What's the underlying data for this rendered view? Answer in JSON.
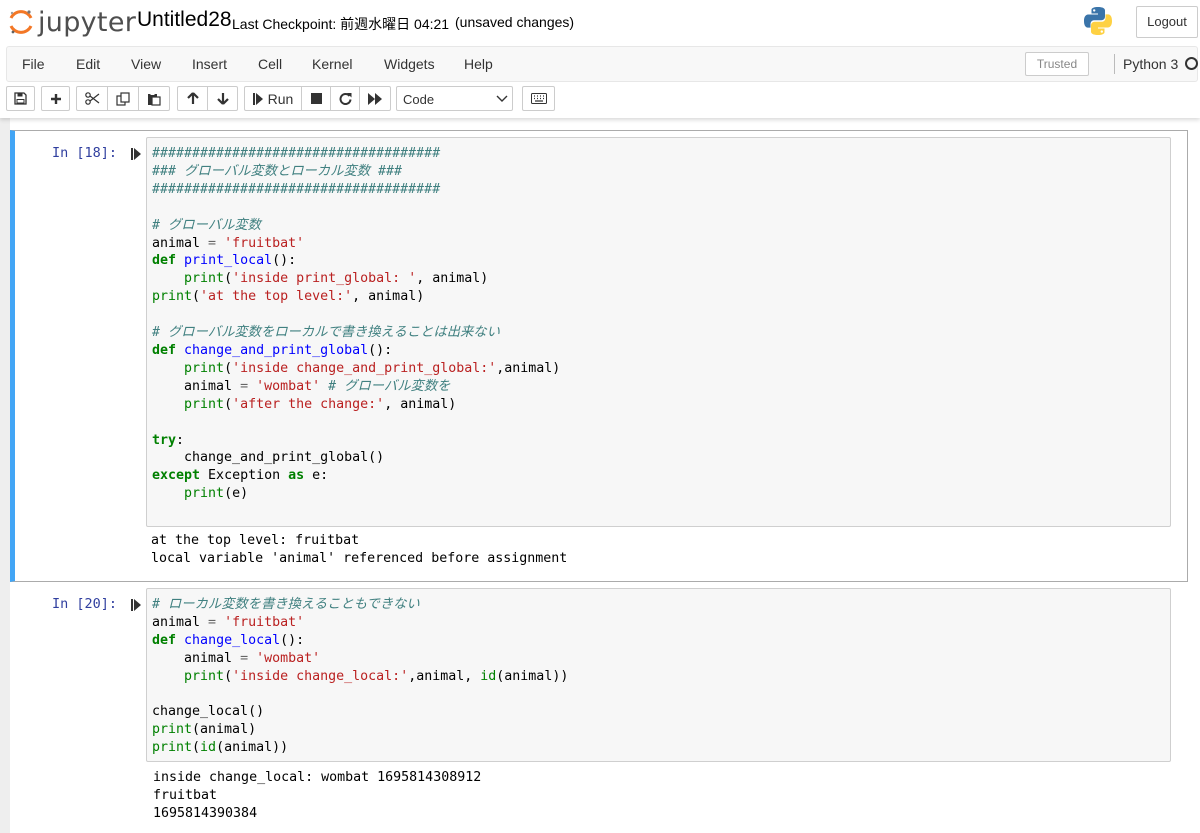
{
  "header": {
    "logo_text": "jupyter",
    "notebook_name": "Untitled28",
    "checkpoint": "Last Checkpoint: 前週水曜日 04:21",
    "autosave_status": "(unsaved changes)",
    "logout_label": "Logout"
  },
  "menubar": {
    "items": [
      "File",
      "Edit",
      "View",
      "Insert",
      "Cell",
      "Kernel",
      "Widgets",
      "Help"
    ],
    "trusted_label": "Trusted",
    "kernel_name": "Python 3"
  },
  "toolbar": {
    "run_label": "Run",
    "cell_type": "Code",
    "icons": [
      "save-icon",
      "plus-icon",
      "cut-icon",
      "copy-icon",
      "paste-icon",
      "arrow-up-icon",
      "arrow-down-icon",
      "step-forward-icon",
      "stop-icon",
      "restart-icon",
      "fast-forward-icon",
      "keyboard-icon"
    ]
  },
  "cells": [
    {
      "prompt": "In [18]:",
      "selected": true,
      "code": "####################################\n### グローバル変数とローカル変数 ###\n####################################\n\n# グローバル変数\nanimal = 'fruitbat'\ndef print_local():\n    print('inside print_global: ', animal)\nprint('at the top level:', animal)\n\n# グローバル変数をローカルで書き換えることは出来ない\ndef change_and_print_global():\n    print('inside change_and_print_global:',animal)\n    animal = 'wombat' # グローバル変数を\n    print('after the change:', animal)\n\ntry:\n    change_and_print_global()\nexcept Exception as e:\n    print(e)",
      "output": "at the top level: fruitbat\nlocal variable 'animal' referenced before assignment"
    },
    {
      "prompt": "In [20]:",
      "selected": false,
      "code": "# ローカル変数を書き換えることもできない\nanimal = 'fruitbat'\ndef change_local():\n    animal = 'wombat'\n    print('inside change_local:',animal, id(animal))\n\nchange_local()\nprint(animal)\nprint(id(animal))",
      "output": "inside change_local: wombat 1695814308912\nfruitbat\n1695814390384"
    }
  ]
}
